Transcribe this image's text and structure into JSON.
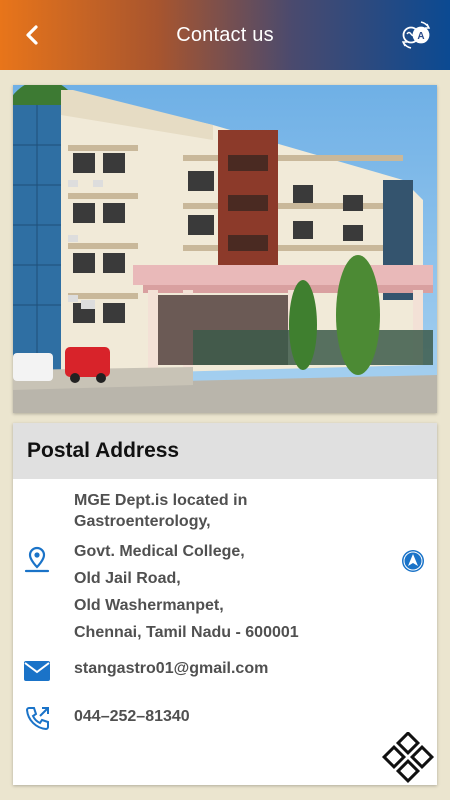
{
  "header": {
    "title": "Contact us",
    "gradient_start": "#e8751a",
    "gradient_end": "#0b4a92",
    "back_icon": "chevron-left-icon",
    "translate_icon": "language-translate-icon"
  },
  "photo": {
    "icon": "hospital-building-photo"
  },
  "postal": {
    "heading": "Postal Address",
    "address_lines": [
      "MGE Dept.is located in",
      "Gastroenterology,",
      "Govt. Medical College,",
      "Old Jail Road,",
      "Old Washermanpet,",
      "Chennai, Tamil Nadu - 600001"
    ],
    "email": "stangastro01@gmail.com",
    "phone": "044–252–81340",
    "accent_color": "#1a73c8"
  },
  "fab": {
    "icon": "diamond-grid-menu-icon"
  }
}
